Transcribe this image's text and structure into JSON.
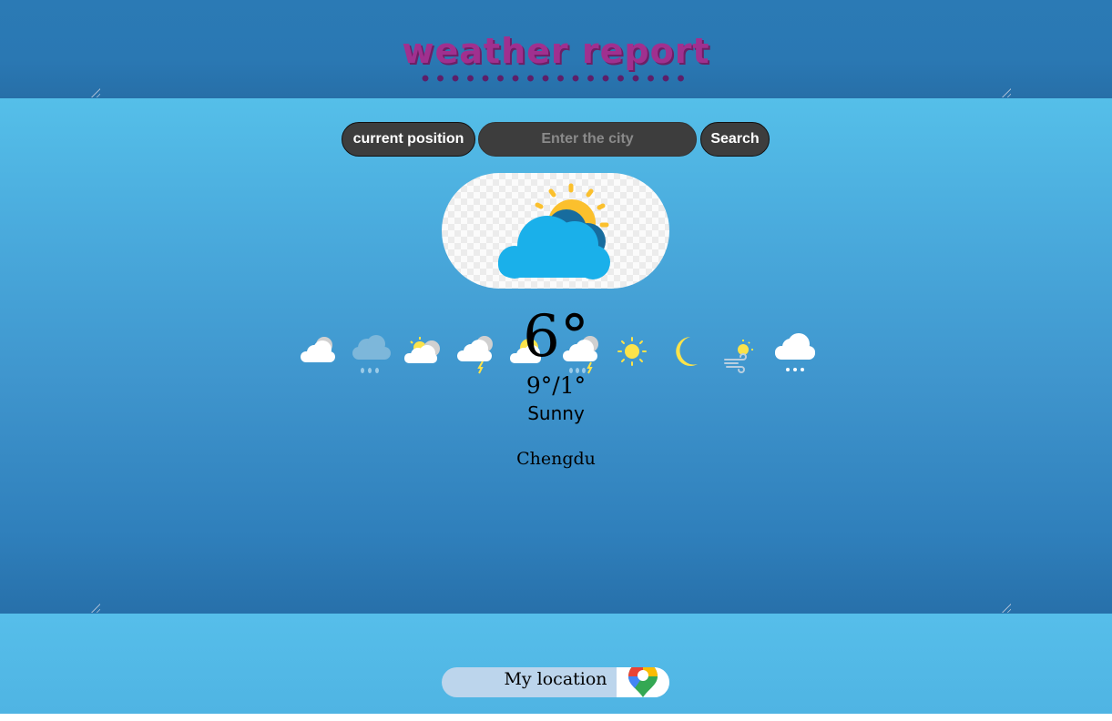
{
  "header": {
    "title": "weather report"
  },
  "search": {
    "current_position_label": "current position",
    "city_placeholder": "Enter the city",
    "city_value": "",
    "search_label": "Search"
  },
  "current": {
    "icon": "sun-behind-cloud-icon",
    "temperature": "6°",
    "range": "9°/1°",
    "condition": "Sunny",
    "city": "Chengdu"
  },
  "icon_strip": [
    "cloudy-icon",
    "rain-icon",
    "partly-cloudy-sun-icon",
    "cloud-thunder-icon",
    "sun-behind-cloud-icon",
    "rain-thunder-icon",
    "sun-icon",
    "moon-icon",
    "windy-sun-icon",
    "snow-cloud-icon"
  ],
  "footer": {
    "my_location_label": "My location",
    "map_icon": "map-pin-icon"
  },
  "colors": {
    "header_bg": "#2a78b3",
    "main_bg_top": "#55bfe9",
    "main_bg_bottom": "#2770aa",
    "title": "#a0308f",
    "button_bg": "#3d3d3d",
    "button_text": "#ffffff",
    "sun": "#fbc02d",
    "cloud": "#1ab0ea"
  }
}
